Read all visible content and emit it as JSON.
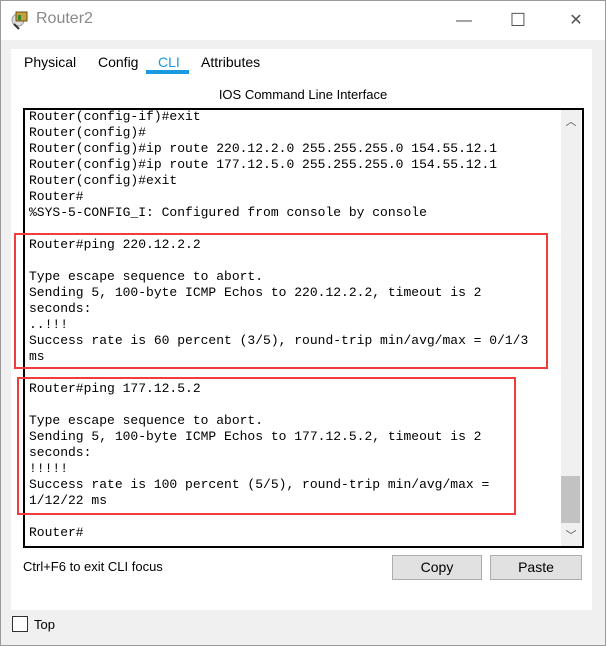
{
  "window": {
    "title": "Router2",
    "minimize": "—",
    "maximize": "☐",
    "close": "✕"
  },
  "tabs": [
    {
      "label": "Physical"
    },
    {
      "label": "Config"
    },
    {
      "label": "CLI",
      "active": true
    },
    {
      "label": "Attributes"
    }
  ],
  "accent_color": "#1a9be0",
  "highlight_color": "#f03c3c",
  "cli": {
    "heading": "IOS Command Line Interface",
    "lines": [
      "Router(config-if)#exit",
      "Router(config)#",
      "Router(config)#ip route 220.12.2.0 255.255.255.0 154.55.12.1",
      "Router(config)#ip route 177.12.5.0 255.255.255.0 154.55.12.1",
      "Router(config)#exit",
      "Router#",
      "%SYS-5-CONFIG_I: Configured from console by console",
      "",
      "Router#ping 220.12.2.2",
      "",
      "Type escape sequence to abort.",
      "Sending 5, 100-byte ICMP Echos to 220.12.2.2, timeout is 2",
      "seconds:",
      "..!!!",
      "Success rate is 60 percent (3/5), round-trip min/avg/max = 0/1/3",
      "ms",
      "",
      "Router#ping 177.12.5.2",
      "",
      "Type escape sequence to abort.",
      "Sending 5, 100-byte ICMP Echos to 177.12.5.2, timeout is 2",
      "seconds:",
      "!!!!!",
      "Success rate is 100 percent (5/5), round-trip min/avg/max =",
      "1/12/22 ms",
      "",
      "Router#"
    ],
    "scroll_up": "︿",
    "scroll_down": "﹀"
  },
  "footer": {
    "hint": "Ctrl+F6 to exit CLI focus",
    "copy": "Copy",
    "paste": "Paste"
  },
  "top_checkbox": {
    "label": "Top",
    "checked": false
  }
}
